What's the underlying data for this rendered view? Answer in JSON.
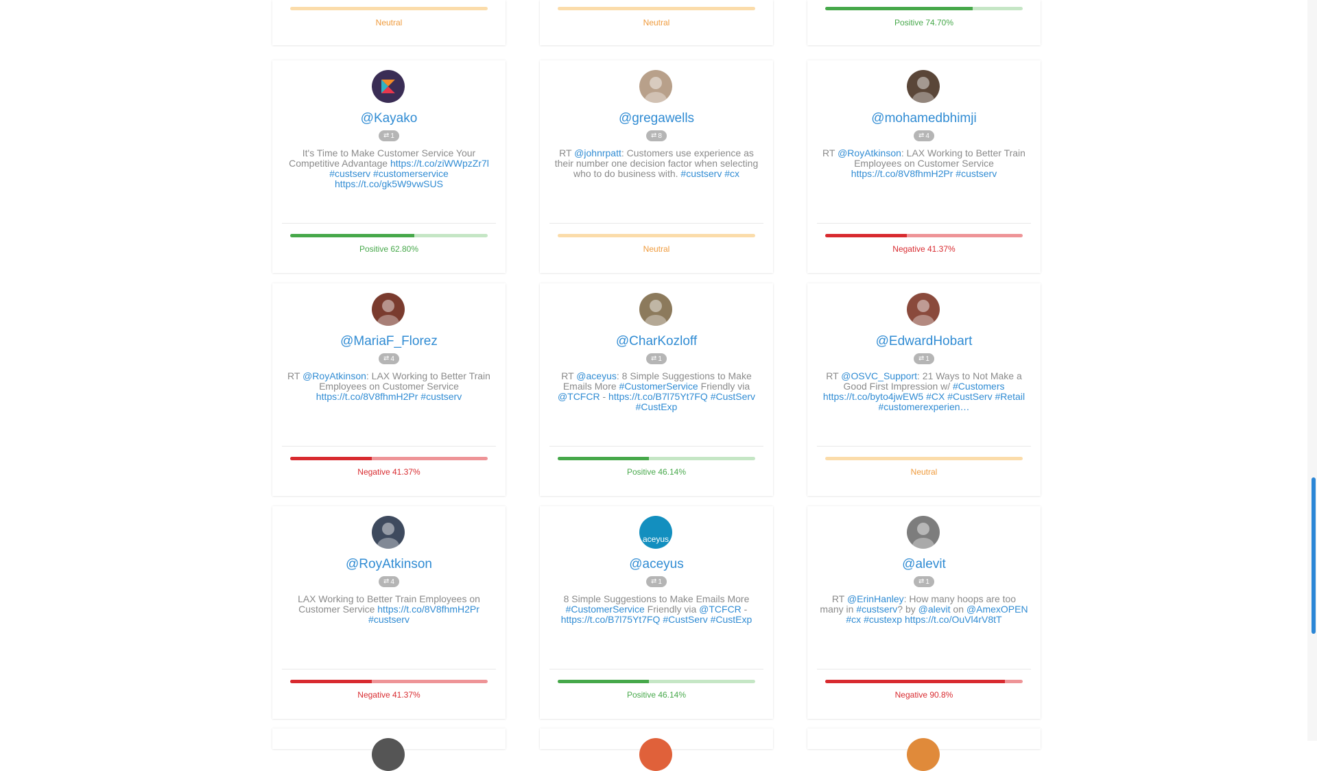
{
  "colors": {
    "link": "#2f8bd3",
    "positive": "#46a84a",
    "negative": "#d82a2f",
    "neutral": "#ef9a3b",
    "scrollbar": "#2b86d6"
  },
  "top_row": [
    {
      "sentiment": "neutral",
      "label": "Neutral",
      "fill": 0
    },
    {
      "sentiment": "neutral",
      "label": "Neutral",
      "fill": 0
    },
    {
      "sentiment": "positive",
      "label": "Positive 74.70%",
      "fill": 0.747
    }
  ],
  "cards": [
    {
      "handle": "@Kayako",
      "avatar": {
        "icon": "kayako-logo-icon",
        "bg": "#3a2d55"
      },
      "retweets": "1",
      "text": [
        {
          "t": "It's Time to Make Customer Service Your Competitive Advantage "
        },
        {
          "t": "https://t.co/ziWWpzZr7l",
          "link": true
        },
        {
          "t": " "
        },
        {
          "t": "#custserv",
          "link": true
        },
        {
          "t": " "
        },
        {
          "t": "#customerservice",
          "link": true
        },
        {
          "t": " "
        },
        {
          "t": "https://t.co/gk5W9vwSUS",
          "link": true
        }
      ],
      "sentiment": "positive",
      "label": "Positive 62.80%",
      "fill": 0.628
    },
    {
      "handle": "@gregawells",
      "avatar": {
        "icon": "profile-photo-icon",
        "bg": "#b8a08a"
      },
      "retweets": "8",
      "text": [
        {
          "t": "RT "
        },
        {
          "t": "@johnrpatt",
          "link": true
        },
        {
          "t": ": Customers use experience as their number one decision factor when selecting who to do business with. "
        },
        {
          "t": "#custserv",
          "link": true
        },
        {
          "t": " "
        },
        {
          "t": "#cx",
          "link": true
        }
      ],
      "sentiment": "neutral",
      "label": "Neutral",
      "fill": 0
    },
    {
      "handle": "@mohamedbhimji",
      "avatar": {
        "icon": "profile-photo-icon",
        "bg": "#5a4638"
      },
      "retweets": "4",
      "text": [
        {
          "t": "RT "
        },
        {
          "t": "@RoyAtkinson",
          "link": true
        },
        {
          "t": ": LAX Working to Better Train Employees on Customer Service "
        },
        {
          "t": "https://t.co/8V8fhmH2Pr",
          "link": true
        },
        {
          "t": " "
        },
        {
          "t": "#custserv",
          "link": true
        }
      ],
      "sentiment": "negative",
      "label": "Negative 41.37%",
      "fill": 0.4137
    },
    {
      "handle": "@MariaF_Florez",
      "avatar": {
        "icon": "profile-photo-icon",
        "bg": "#7a3b2e"
      },
      "retweets": "4",
      "text": [
        {
          "t": "RT "
        },
        {
          "t": "@RoyAtkinson",
          "link": true
        },
        {
          "t": ": LAX Working to Better Train Employees on Customer Service "
        },
        {
          "t": "https://t.co/8V8fhmH2Pr",
          "link": true
        },
        {
          "t": " "
        },
        {
          "t": "#custserv",
          "link": true
        }
      ],
      "sentiment": "negative",
      "label": "Negative 41.37%",
      "fill": 0.4137
    },
    {
      "handle": "@CharKozloff",
      "avatar": {
        "icon": "profile-photo-icon",
        "bg": "#8c7a5c"
      },
      "retweets": "1",
      "text": [
        {
          "t": "RT "
        },
        {
          "t": "@aceyus",
          "link": true
        },
        {
          "t": ": 8 Simple Suggestions to Make Emails More "
        },
        {
          "t": "#CustomerService",
          "link": true
        },
        {
          "t": " Friendly via "
        },
        {
          "t": "@TCFCR",
          "link": true
        },
        {
          "t": " - "
        },
        {
          "t": "https://t.co/B7l75Yt7FQ",
          "link": true
        },
        {
          "t": " "
        },
        {
          "t": "#CustServ",
          "link": true
        },
        {
          "t": " "
        },
        {
          "t": "#CustExp",
          "link": true
        }
      ],
      "sentiment": "positive",
      "label": "Positive 46.14%",
      "fill": 0.4614
    },
    {
      "handle": "@EdwardHobart",
      "avatar": {
        "icon": "profile-photo-icon",
        "bg": "#8a4a3c"
      },
      "retweets": "1",
      "text": [
        {
          "t": "RT "
        },
        {
          "t": "@OSVC_Support",
          "link": true
        },
        {
          "t": ": 21 Ways to Not Make a Good First Impression w/ "
        },
        {
          "t": "#Customers",
          "link": true
        },
        {
          "t": " "
        },
        {
          "t": "https://t.co/byto4jwEW5",
          "link": true
        },
        {
          "t": " "
        },
        {
          "t": "#CX",
          "link": true
        },
        {
          "t": " "
        },
        {
          "t": "#CustServ",
          "link": true
        },
        {
          "t": " "
        },
        {
          "t": "#Retail",
          "link": true
        },
        {
          "t": " "
        },
        {
          "t": "#customerexperien…",
          "link": true
        }
      ],
      "sentiment": "neutral",
      "label": "Neutral",
      "fill": 0
    },
    {
      "handle": "@RoyAtkinson",
      "avatar": {
        "icon": "profile-photo-icon",
        "bg": "#3e4a5e"
      },
      "retweets": "4",
      "text": [
        {
          "t": "LAX Working to Better Train Employees on Customer Service "
        },
        {
          "t": "https://t.co/8V8fhmH2Pr",
          "link": true
        },
        {
          "t": " "
        },
        {
          "t": "#custserv",
          "link": true
        }
      ],
      "sentiment": "negative",
      "label": "Negative 41.37%",
      "fill": 0.4137
    },
    {
      "handle": "@aceyus",
      "avatar": {
        "icon": "aceyus-logo-icon",
        "bg": "#138fbf",
        "initial": "aceyus"
      },
      "retweets": "1",
      "text": [
        {
          "t": "8 Simple Suggestions to Make Emails More "
        },
        {
          "t": "#CustomerService",
          "link": true
        },
        {
          "t": " Friendly via "
        },
        {
          "t": "@TCFCR",
          "link": true
        },
        {
          "t": " - "
        },
        {
          "t": "https://t.co/B7l75Yt7FQ",
          "link": true
        },
        {
          "t": " "
        },
        {
          "t": "#CustServ",
          "link": true
        },
        {
          "t": " "
        },
        {
          "t": "#CustExp",
          "link": true
        }
      ],
      "sentiment": "positive",
      "label": "Positive 46.14%",
      "fill": 0.4614
    },
    {
      "handle": "@alevit",
      "avatar": {
        "icon": "profile-photo-icon",
        "bg": "#7d7d7d"
      },
      "retweets": "1",
      "text": [
        {
          "t": "RT "
        },
        {
          "t": "@ErinHanley",
          "link": true
        },
        {
          "t": ": How many hoops are too many in "
        },
        {
          "t": "#custserv",
          "link": true
        },
        {
          "t": "? by "
        },
        {
          "t": "@alevit",
          "link": true
        },
        {
          "t": " on "
        },
        {
          "t": "@AmexOPEN",
          "link": true
        },
        {
          "t": " "
        },
        {
          "t": "#cx",
          "link": true
        },
        {
          "t": " "
        },
        {
          "t": "#custexp",
          "link": true
        },
        {
          "t": " "
        },
        {
          "t": "https://t.co/OuVl4rV8tT",
          "link": true
        }
      ],
      "sentiment": "negative",
      "label": "Negative 90.8%",
      "fill": 0.908
    }
  ],
  "bottom_row": [
    {
      "avatar_bg": "#555555"
    },
    {
      "avatar_bg": "#e0613a"
    },
    {
      "avatar_bg": "#e08a3a"
    }
  ]
}
